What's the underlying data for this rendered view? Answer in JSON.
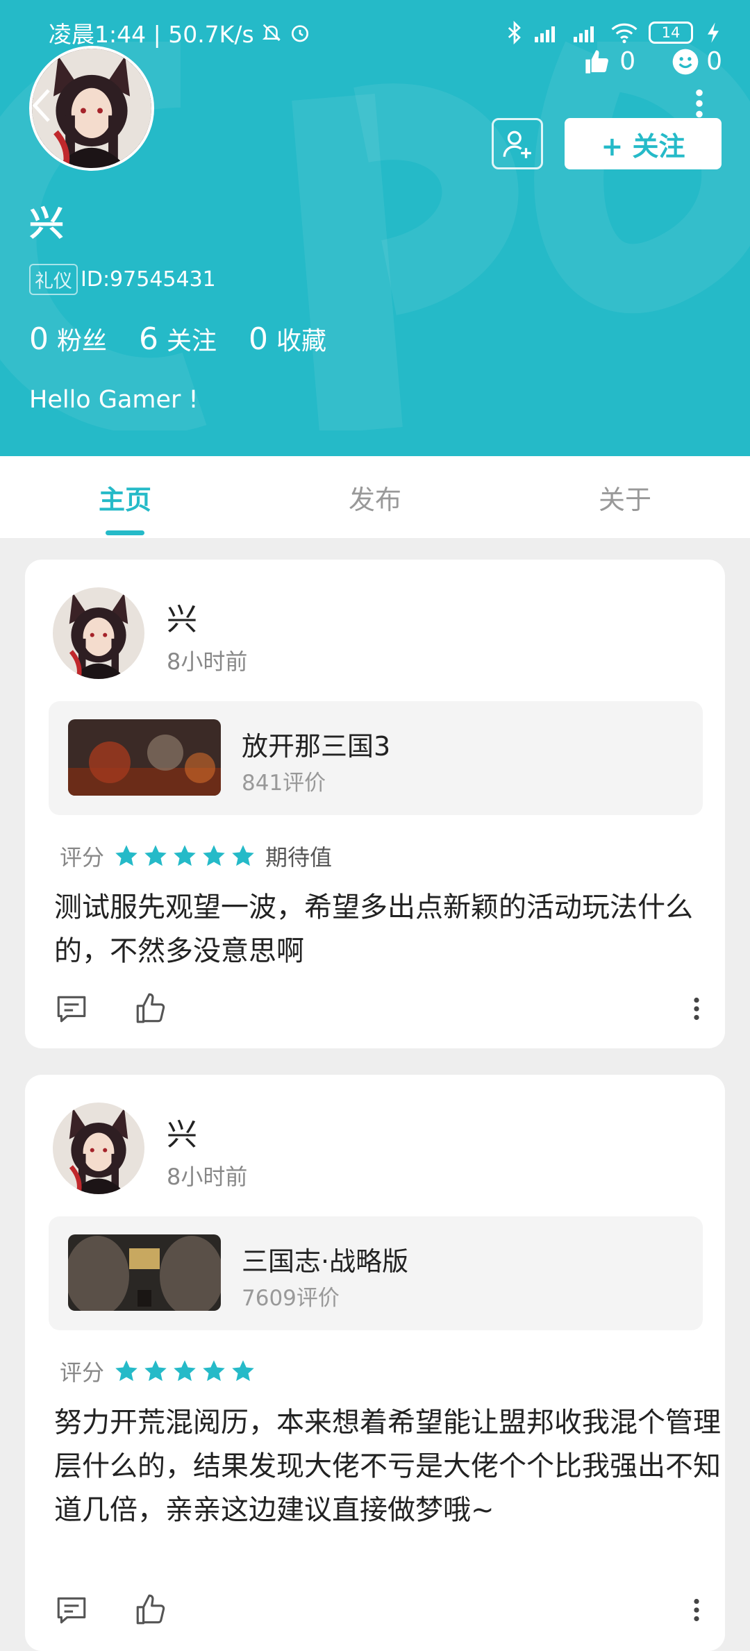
{
  "status_bar": {
    "time_speed": "凌晨1:44 | 50.7K/s",
    "battery": "14"
  },
  "header": {
    "likes": "0",
    "emoji_count": "0",
    "follow_label": "+ 关注",
    "username": "兴",
    "tag": "礼仪",
    "user_id": "ID:97545431",
    "fans_count": "0",
    "fans_label": "粉丝",
    "following_count": "6",
    "following_label": "关注",
    "favorites_count": "0",
    "favorites_label": "收藏",
    "bio": "Hello Gamer !",
    "colors": {
      "accent": "#25bac8"
    }
  },
  "tabs": [
    {
      "label": "主页",
      "active": true
    },
    {
      "label": "发布",
      "active": false
    },
    {
      "label": "关于",
      "active": false
    }
  ],
  "posts": [
    {
      "author": "兴",
      "time": "8小时前",
      "game": "放开那三国3",
      "reviews": "841评价",
      "rating_label": "评分",
      "stars": 5,
      "expectation": "期待值",
      "text": "测试服先观望一波，希望多出点新颖的活动玩法什么的，不然多没意思啊"
    },
    {
      "author": "兴",
      "time": "8小时前",
      "game": "三国志·战略版",
      "reviews": "7609评价",
      "rating_label": "评分",
      "stars": 5,
      "text": "努力开荒混阅历，本来想着希望能让盟邦收我混个管理层什么的，结果发现大佬不亏是大佬个个比我强出不知道几倍，亲亲这边建议直接做梦哦~"
    }
  ]
}
